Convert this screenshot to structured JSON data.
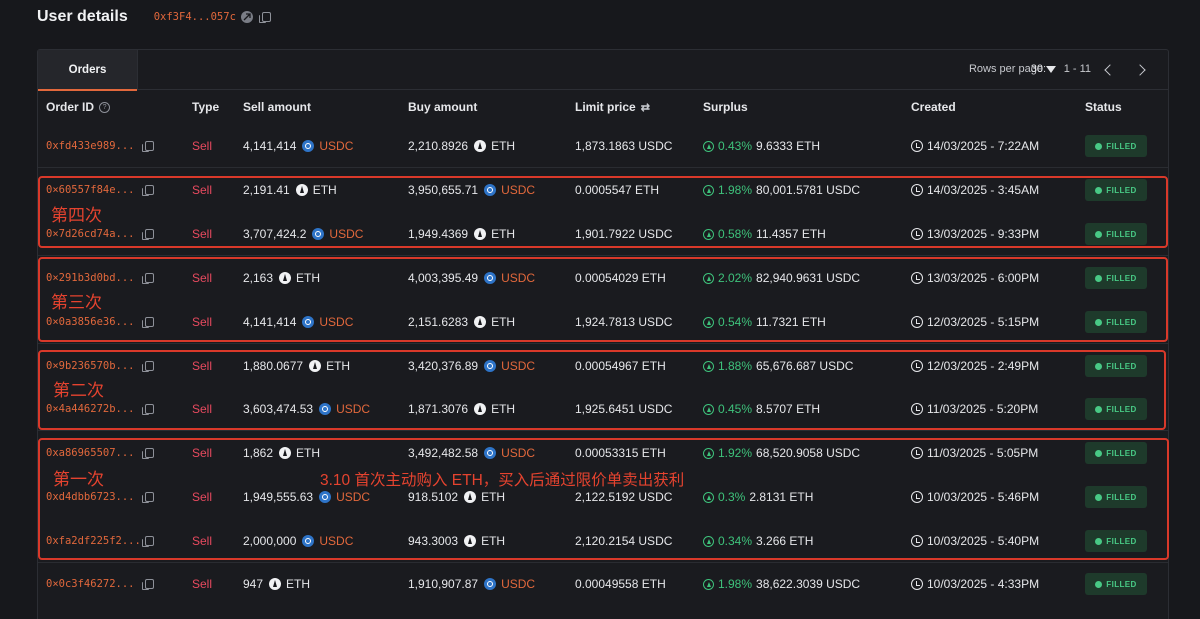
{
  "header": {
    "title": "User details",
    "address": "0xf3F4...057c"
  },
  "tabs": {
    "orders": "Orders"
  },
  "pagination": {
    "rows_per_page_label": "Rows per page:",
    "rows_per_page_value": "30",
    "range": "1 - 11"
  },
  "columns": {
    "order_id": "Order ID",
    "type": "Type",
    "sell_amount": "Sell amount",
    "buy_amount": "Buy amount",
    "limit_price": "Limit price",
    "surplus": "Surplus",
    "created": "Created",
    "status": "Status"
  },
  "orders": [
    {
      "id": "0xfd433e989...",
      "type": "Sell",
      "sell_amount": "4,141,414",
      "sell_token": "USDC",
      "buy_amount": "2,210.8926",
      "buy_token": "ETH",
      "limit_price": "1,873.1863 USDC",
      "surplus_pct": "0.43%",
      "surplus_value": "9.6333 ETH",
      "created": "14/03/2025 - 7:22AM",
      "status": "FILLED"
    },
    {
      "id": "0×60557f84e...",
      "type": "Sell",
      "sell_amount": "2,191.41",
      "sell_token": "ETH",
      "buy_amount": "3,950,655.71",
      "buy_token": "USDC",
      "limit_price": "0.0005547 ETH",
      "surplus_pct": "1.98%",
      "surplus_value": "80,001.5781 USDC",
      "created": "14/03/2025 - 3:45AM",
      "status": "FILLED"
    },
    {
      "id": "0×7d26cd74a...",
      "type": "Sell",
      "sell_amount": "3,707,424.2",
      "sell_token": "USDC",
      "buy_amount": "1,949.4369",
      "buy_token": "ETH",
      "limit_price": "1,901.7922 USDC",
      "surplus_pct": "0.58%",
      "surplus_value": "11.4357 ETH",
      "created": "13/03/2025 - 9:33PM",
      "status": "FILLED"
    },
    {
      "id": "0×291b3d0bd...",
      "type": "Sell",
      "sell_amount": "2,163",
      "sell_token": "ETH",
      "buy_amount": "4,003,395.49",
      "buy_token": "USDC",
      "limit_price": "0.00054029 ETH",
      "surplus_pct": "2.02%",
      "surplus_value": "82,940.9631 USDC",
      "created": "13/03/2025 - 6:00PM",
      "status": "FILLED"
    },
    {
      "id": "0×0a3856e36...",
      "type": "Sell",
      "sell_amount": "4,141,414",
      "sell_token": "USDC",
      "buy_amount": "2,151.6283",
      "buy_token": "ETH",
      "limit_price": "1,924.7813 USDC",
      "surplus_pct": "0.54%",
      "surplus_value": "11.7321 ETH",
      "created": "12/03/2025 - 5:15PM",
      "status": "FILLED"
    },
    {
      "id": "0×9b236570b...",
      "type": "Sell",
      "sell_amount": "1,880.0677",
      "sell_token": "ETH",
      "buy_amount": "3,420,376.89",
      "buy_token": "USDC",
      "limit_price": "0.00054967 ETH",
      "surplus_pct": "1.88%",
      "surplus_value": "65,676.687 USDC",
      "created": "12/03/2025 - 2:49PM",
      "status": "FILLED"
    },
    {
      "id": "0×4a446272b...",
      "type": "Sell",
      "sell_amount": "3,603,474.53",
      "sell_token": "USDC",
      "buy_amount": "1,871.3076",
      "buy_token": "ETH",
      "limit_price": "1,925.6451 USDC",
      "surplus_pct": "0.45%",
      "surplus_value": "8.5707 ETH",
      "created": "11/03/2025 - 5:20PM",
      "status": "FILLED"
    },
    {
      "id": "0xa86965507...",
      "type": "Sell",
      "sell_amount": "1,862",
      "sell_token": "ETH",
      "buy_amount": "3,492,482.58",
      "buy_token": "USDC",
      "limit_price": "0.00053315 ETH",
      "surplus_pct": "1.92%",
      "surplus_value": "68,520.9058 USDC",
      "created": "11/03/2025 - 5:05PM",
      "status": "FILLED"
    },
    {
      "id": "0xd4dbb6723...",
      "type": "Sell",
      "sell_amount": "1,949,555.63",
      "sell_token": "USDC",
      "buy_amount": "918.5102",
      "buy_token": "ETH",
      "limit_price": "2,122.5192 USDC",
      "surplus_pct": "0.3%",
      "surplus_value": "2.8131 ETH",
      "created": "10/03/2025 - 5:46PM",
      "status": "FILLED"
    },
    {
      "id": "0xfa2df225f2...",
      "type": "Sell",
      "sell_amount": "2,000,000",
      "sell_token": "USDC",
      "buy_amount": "943.3003",
      "buy_token": "ETH",
      "limit_price": "2,120.2154 USDC",
      "surplus_pct": "0.34%",
      "surplus_value": "3.266 ETH",
      "created": "10/03/2025 - 5:40PM",
      "status": "FILLED"
    },
    {
      "id": "0×0c3f46272...",
      "type": "Sell",
      "sell_amount": "947",
      "sell_token": "ETH",
      "buy_amount": "1,910,907.87",
      "buy_token": "USDC",
      "limit_price": "0.00049558 ETH",
      "surplus_pct": "1.98%",
      "surplus_value": "38,622.3039 USDC",
      "created": "10/03/2025 - 4:33PM",
      "status": "FILLED"
    }
  ],
  "annotations": {
    "fourth": "第四次",
    "third": "第三次",
    "second": "第二次",
    "first": "第一次",
    "note": "3.10 首次主动购入 ETH，买入后通过限价单卖出获利"
  },
  "colors": {
    "accent": "#e2683c",
    "sell": "#e84a5f",
    "positive": "#3ec27b",
    "annotation": "#d9392a"
  }
}
